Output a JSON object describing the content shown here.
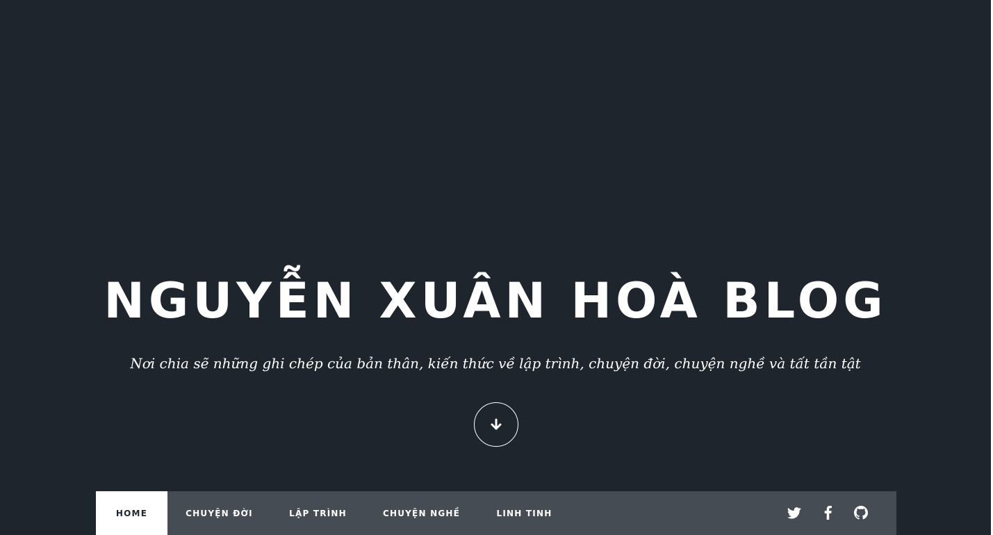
{
  "header": {
    "title": "NGUYỄN XUÂN HOÀ BLOG",
    "tagline": "Nơi chia sẽ những ghi chép của bản thân, kiến thức về lập trình, chuyện đời, chuyện nghề và tất tần tật",
    "scroll_icon": "arrow-down-icon"
  },
  "nav": {
    "items": [
      {
        "label": "HOME",
        "active": true
      },
      {
        "label": "CHUYỆN ĐỜI",
        "active": false
      },
      {
        "label": "LẬP TRÌNH",
        "active": false
      },
      {
        "label": "CHUYỆN NGHỀ",
        "active": false
      },
      {
        "label": "LINH TINH",
        "active": false
      }
    ],
    "social_icons": [
      "twitter-icon",
      "facebook-icon",
      "github-icon"
    ]
  },
  "colors": {
    "background": "#1f252d",
    "navbar": "#464c54",
    "active_tab": "#ffffff",
    "text": "#ffffff"
  }
}
